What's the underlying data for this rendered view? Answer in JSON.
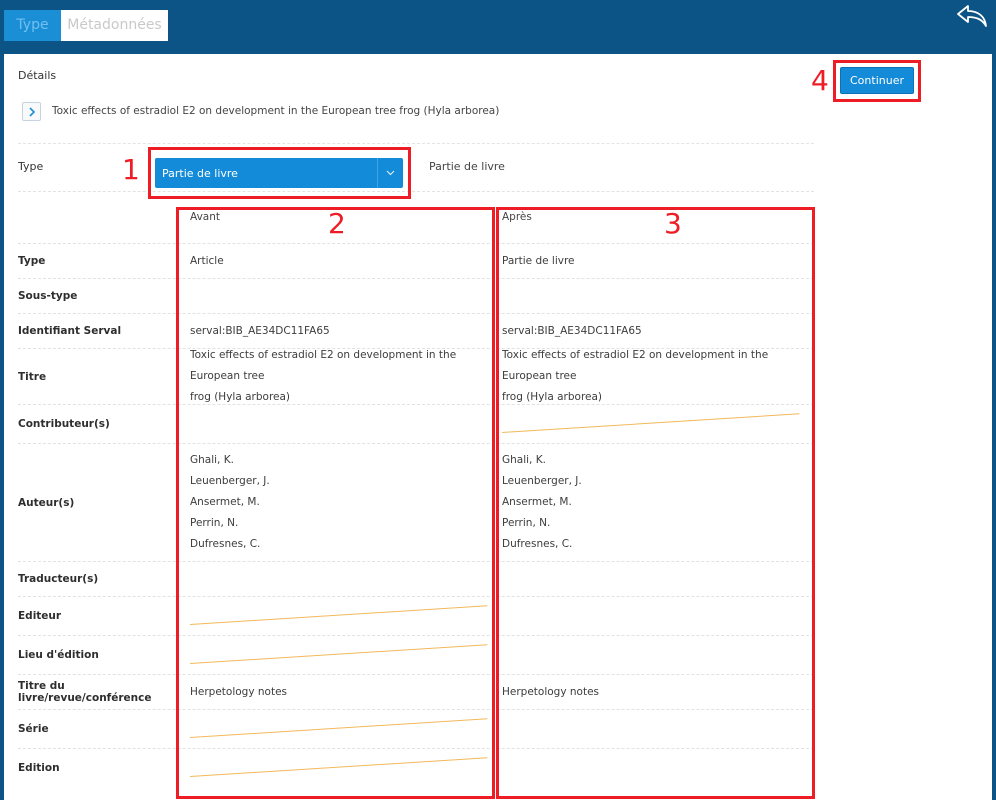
{
  "tabs": [
    {
      "label": "Type"
    },
    {
      "label": "Métadonnées"
    }
  ],
  "details": {
    "label": "Détails",
    "publication_title": "Toxic effects of estradiol E2 on development in the European tree frog (Hyla arborea)"
  },
  "type_selector": {
    "label": "Type",
    "selected": "Partie de livre",
    "current_display": "Partie de livre"
  },
  "continue_button": {
    "label": "Continuer"
  },
  "comparison": {
    "col_before": "Avant",
    "col_after": "Après",
    "rows": [
      {
        "label": "Type",
        "before": [
          "Article"
        ],
        "after": [
          "Partie de livre"
        ]
      },
      {
        "label": "Sous-type",
        "before": [],
        "after": []
      },
      {
        "label": "Identifiant Serval",
        "before": [
          "serval:BIB_AE34DC11FA65"
        ],
        "after": [
          "serval:BIB_AE34DC11FA65"
        ]
      },
      {
        "label": "Titre",
        "before": [
          "Toxic effects of estradiol E2 on development in the European tree",
          "frog (Hyla arborea)"
        ],
        "after": [
          "Toxic effects of estradiol E2 on development in the European tree",
          "frog (Hyla arborea)"
        ]
      },
      {
        "label": "Contributeur(s)",
        "before": [],
        "after": [],
        "after_removed": true
      },
      {
        "label": "Auteur(s)",
        "before": [
          "Ghali, K.",
          "Leuenberger, J.",
          "Ansermet, M.",
          "Perrin, N.",
          "Dufresnes, C."
        ],
        "after": [
          "Ghali, K.",
          "Leuenberger, J.",
          "Ansermet, M.",
          "Perrin, N.",
          "Dufresnes, C."
        ]
      },
      {
        "label": "Traducteur(s)",
        "before": [],
        "after": []
      },
      {
        "label": "Editeur",
        "before": [],
        "after": [],
        "before_removed": true
      },
      {
        "label": "Lieu d'édition",
        "before": [],
        "after": [],
        "before_removed": true
      },
      {
        "label": "Titre du livre/revue/conférence",
        "before": [
          "Herpetology notes"
        ],
        "after": [
          "Herpetology notes"
        ]
      },
      {
        "label": "Série",
        "before": [],
        "after": [],
        "before_removed": true
      },
      {
        "label": "Edition",
        "before": [],
        "after": [],
        "before_removed": true
      }
    ]
  },
  "annotations": [
    {
      "number": "1"
    },
    {
      "number": "2"
    },
    {
      "number": "3"
    },
    {
      "number": "4"
    }
  ],
  "colors": {
    "header_bg": "#0c5486",
    "primary": "#138bd8",
    "strike": "#f2b95b",
    "annotation": "#ee1c25"
  }
}
